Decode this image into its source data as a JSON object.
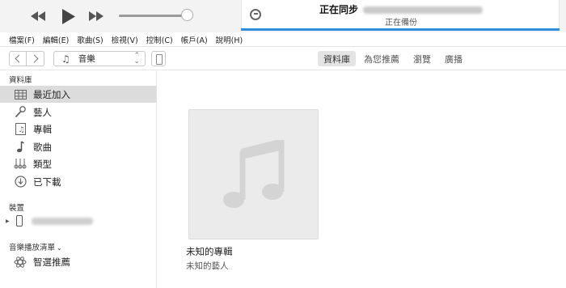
{
  "player": {
    "status_title": "正在同步",
    "status_subtitle": "正在備份"
  },
  "menu": [
    {
      "label": "檔案(F)"
    },
    {
      "label": "編輯(E)"
    },
    {
      "label": "歌曲(S)"
    },
    {
      "label": "檢視(V)"
    },
    {
      "label": "控制(C)"
    },
    {
      "label": "帳戶(A)"
    },
    {
      "label": "說明(H)"
    }
  ],
  "toolbar": {
    "media_kind": "音樂",
    "tabs": [
      {
        "label": "資料庫",
        "active": true
      },
      {
        "label": "為您推薦",
        "active": false
      },
      {
        "label": "瀏覽",
        "active": false
      },
      {
        "label": "廣播",
        "active": false
      }
    ]
  },
  "sidebar": {
    "library_header": "資料庫",
    "library_items": [
      {
        "label": "最近加入",
        "icon": "grid-icon",
        "selected": true
      },
      {
        "label": "藝人",
        "icon": "microphone-icon",
        "selected": false
      },
      {
        "label": "專輯",
        "icon": "album-icon",
        "selected": false
      },
      {
        "label": "歌曲",
        "icon": "music-note-icon",
        "selected": false
      },
      {
        "label": "類型",
        "icon": "genre-icon",
        "selected": false
      },
      {
        "label": "已下載",
        "icon": "download-icon",
        "selected": false
      }
    ],
    "devices_header": "裝置",
    "playlists_header": "音樂播放清單",
    "playlist_items": [
      {
        "label": "智選推薦",
        "icon": "genius-atom-icon"
      }
    ]
  },
  "main": {
    "album": {
      "title": "未知的專輯",
      "artist": "未知的藝人"
    }
  },
  "colors": {
    "progress_accent": "#2f8fdd",
    "selection_bg": "#dcdcdc",
    "artwork_bg": "#ebebeb"
  }
}
